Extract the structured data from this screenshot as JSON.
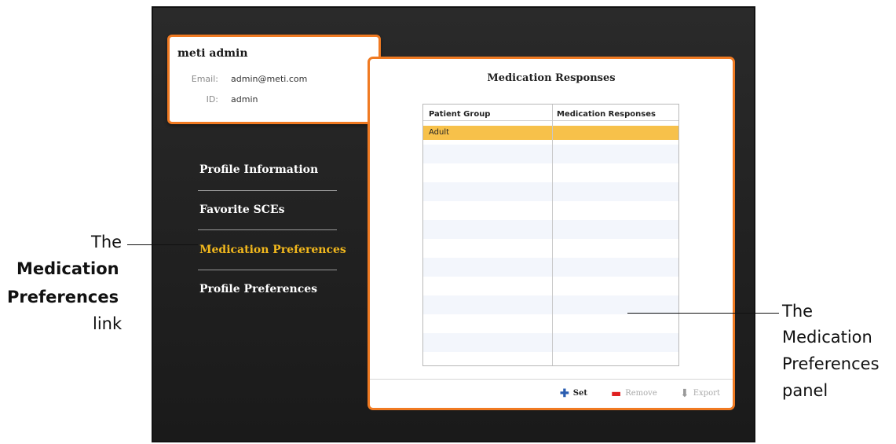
{
  "profile": {
    "name": "meti admin",
    "email_label": "Email:",
    "email_value": "admin@meti.com",
    "id_label": "ID:",
    "id_value": "admin"
  },
  "nav": {
    "items": [
      {
        "label": "Profile Information"
      },
      {
        "label": "Favorite SCEs"
      },
      {
        "label": "Medication Preferences",
        "active": true
      },
      {
        "label": "Profile Preferences"
      }
    ]
  },
  "panel": {
    "title": "Medication Responses",
    "columns": [
      "Patient Group",
      "Medication Responses"
    ],
    "rows": [
      {
        "patient_group": "Adult",
        "medication_responses": "",
        "selected": true
      }
    ],
    "actions": {
      "set_label": "Set",
      "remove_label": "Remove",
      "export_label": "Export"
    }
  },
  "annotations": {
    "left_line1": "The",
    "left_line2": "Medication",
    "left_line3": "Preferences",
    "left_line4": "link",
    "right_line1": "The",
    "right_line2": "Medication",
    "right_line3": "Preferences",
    "right_line4": "panel"
  },
  "colors": {
    "accent_orange": "#f07a22",
    "active_nav": "#f2b81d",
    "selected_row": "#f7c14a",
    "set_icon": "#2a5db0",
    "remove_icon": "#e02020"
  },
  "icons": {
    "set": "plus-icon",
    "remove": "minus-icon",
    "export": "down-arrow-icon"
  }
}
